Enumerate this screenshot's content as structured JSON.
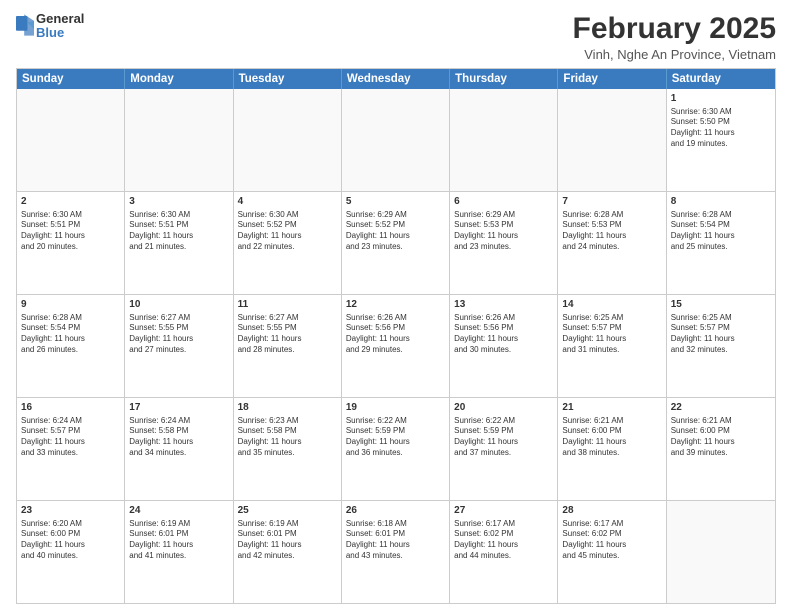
{
  "logo": {
    "line1": "General",
    "line2": "Blue"
  },
  "title": "February 2025",
  "subtitle": "Vinh, Nghe An Province, Vietnam",
  "header_days": [
    "Sunday",
    "Monday",
    "Tuesday",
    "Wednesday",
    "Thursday",
    "Friday",
    "Saturday"
  ],
  "weeks": [
    [
      {
        "day": "",
        "info": ""
      },
      {
        "day": "",
        "info": ""
      },
      {
        "day": "",
        "info": ""
      },
      {
        "day": "",
        "info": ""
      },
      {
        "day": "",
        "info": ""
      },
      {
        "day": "",
        "info": ""
      },
      {
        "day": "1",
        "info": "Sunrise: 6:30 AM\nSunset: 5:50 PM\nDaylight: 11 hours\nand 19 minutes."
      }
    ],
    [
      {
        "day": "2",
        "info": "Sunrise: 6:30 AM\nSunset: 5:51 PM\nDaylight: 11 hours\nand 20 minutes."
      },
      {
        "day": "3",
        "info": "Sunrise: 6:30 AM\nSunset: 5:51 PM\nDaylight: 11 hours\nand 21 minutes."
      },
      {
        "day": "4",
        "info": "Sunrise: 6:30 AM\nSunset: 5:52 PM\nDaylight: 11 hours\nand 22 minutes."
      },
      {
        "day": "5",
        "info": "Sunrise: 6:29 AM\nSunset: 5:52 PM\nDaylight: 11 hours\nand 23 minutes."
      },
      {
        "day": "6",
        "info": "Sunrise: 6:29 AM\nSunset: 5:53 PM\nDaylight: 11 hours\nand 23 minutes."
      },
      {
        "day": "7",
        "info": "Sunrise: 6:28 AM\nSunset: 5:53 PM\nDaylight: 11 hours\nand 24 minutes."
      },
      {
        "day": "8",
        "info": "Sunrise: 6:28 AM\nSunset: 5:54 PM\nDaylight: 11 hours\nand 25 minutes."
      }
    ],
    [
      {
        "day": "9",
        "info": "Sunrise: 6:28 AM\nSunset: 5:54 PM\nDaylight: 11 hours\nand 26 minutes."
      },
      {
        "day": "10",
        "info": "Sunrise: 6:27 AM\nSunset: 5:55 PM\nDaylight: 11 hours\nand 27 minutes."
      },
      {
        "day": "11",
        "info": "Sunrise: 6:27 AM\nSunset: 5:55 PM\nDaylight: 11 hours\nand 28 minutes."
      },
      {
        "day": "12",
        "info": "Sunrise: 6:26 AM\nSunset: 5:56 PM\nDaylight: 11 hours\nand 29 minutes."
      },
      {
        "day": "13",
        "info": "Sunrise: 6:26 AM\nSunset: 5:56 PM\nDaylight: 11 hours\nand 30 minutes."
      },
      {
        "day": "14",
        "info": "Sunrise: 6:25 AM\nSunset: 5:57 PM\nDaylight: 11 hours\nand 31 minutes."
      },
      {
        "day": "15",
        "info": "Sunrise: 6:25 AM\nSunset: 5:57 PM\nDaylight: 11 hours\nand 32 minutes."
      }
    ],
    [
      {
        "day": "16",
        "info": "Sunrise: 6:24 AM\nSunset: 5:57 PM\nDaylight: 11 hours\nand 33 minutes."
      },
      {
        "day": "17",
        "info": "Sunrise: 6:24 AM\nSunset: 5:58 PM\nDaylight: 11 hours\nand 34 minutes."
      },
      {
        "day": "18",
        "info": "Sunrise: 6:23 AM\nSunset: 5:58 PM\nDaylight: 11 hours\nand 35 minutes."
      },
      {
        "day": "19",
        "info": "Sunrise: 6:22 AM\nSunset: 5:59 PM\nDaylight: 11 hours\nand 36 minutes."
      },
      {
        "day": "20",
        "info": "Sunrise: 6:22 AM\nSunset: 5:59 PM\nDaylight: 11 hours\nand 37 minutes."
      },
      {
        "day": "21",
        "info": "Sunrise: 6:21 AM\nSunset: 6:00 PM\nDaylight: 11 hours\nand 38 minutes."
      },
      {
        "day": "22",
        "info": "Sunrise: 6:21 AM\nSunset: 6:00 PM\nDaylight: 11 hours\nand 39 minutes."
      }
    ],
    [
      {
        "day": "23",
        "info": "Sunrise: 6:20 AM\nSunset: 6:00 PM\nDaylight: 11 hours\nand 40 minutes."
      },
      {
        "day": "24",
        "info": "Sunrise: 6:19 AM\nSunset: 6:01 PM\nDaylight: 11 hours\nand 41 minutes."
      },
      {
        "day": "25",
        "info": "Sunrise: 6:19 AM\nSunset: 6:01 PM\nDaylight: 11 hours\nand 42 minutes."
      },
      {
        "day": "26",
        "info": "Sunrise: 6:18 AM\nSunset: 6:01 PM\nDaylight: 11 hours\nand 43 minutes."
      },
      {
        "day": "27",
        "info": "Sunrise: 6:17 AM\nSunset: 6:02 PM\nDaylight: 11 hours\nand 44 minutes."
      },
      {
        "day": "28",
        "info": "Sunrise: 6:17 AM\nSunset: 6:02 PM\nDaylight: 11 hours\nand 45 minutes."
      },
      {
        "day": "",
        "info": ""
      }
    ]
  ]
}
